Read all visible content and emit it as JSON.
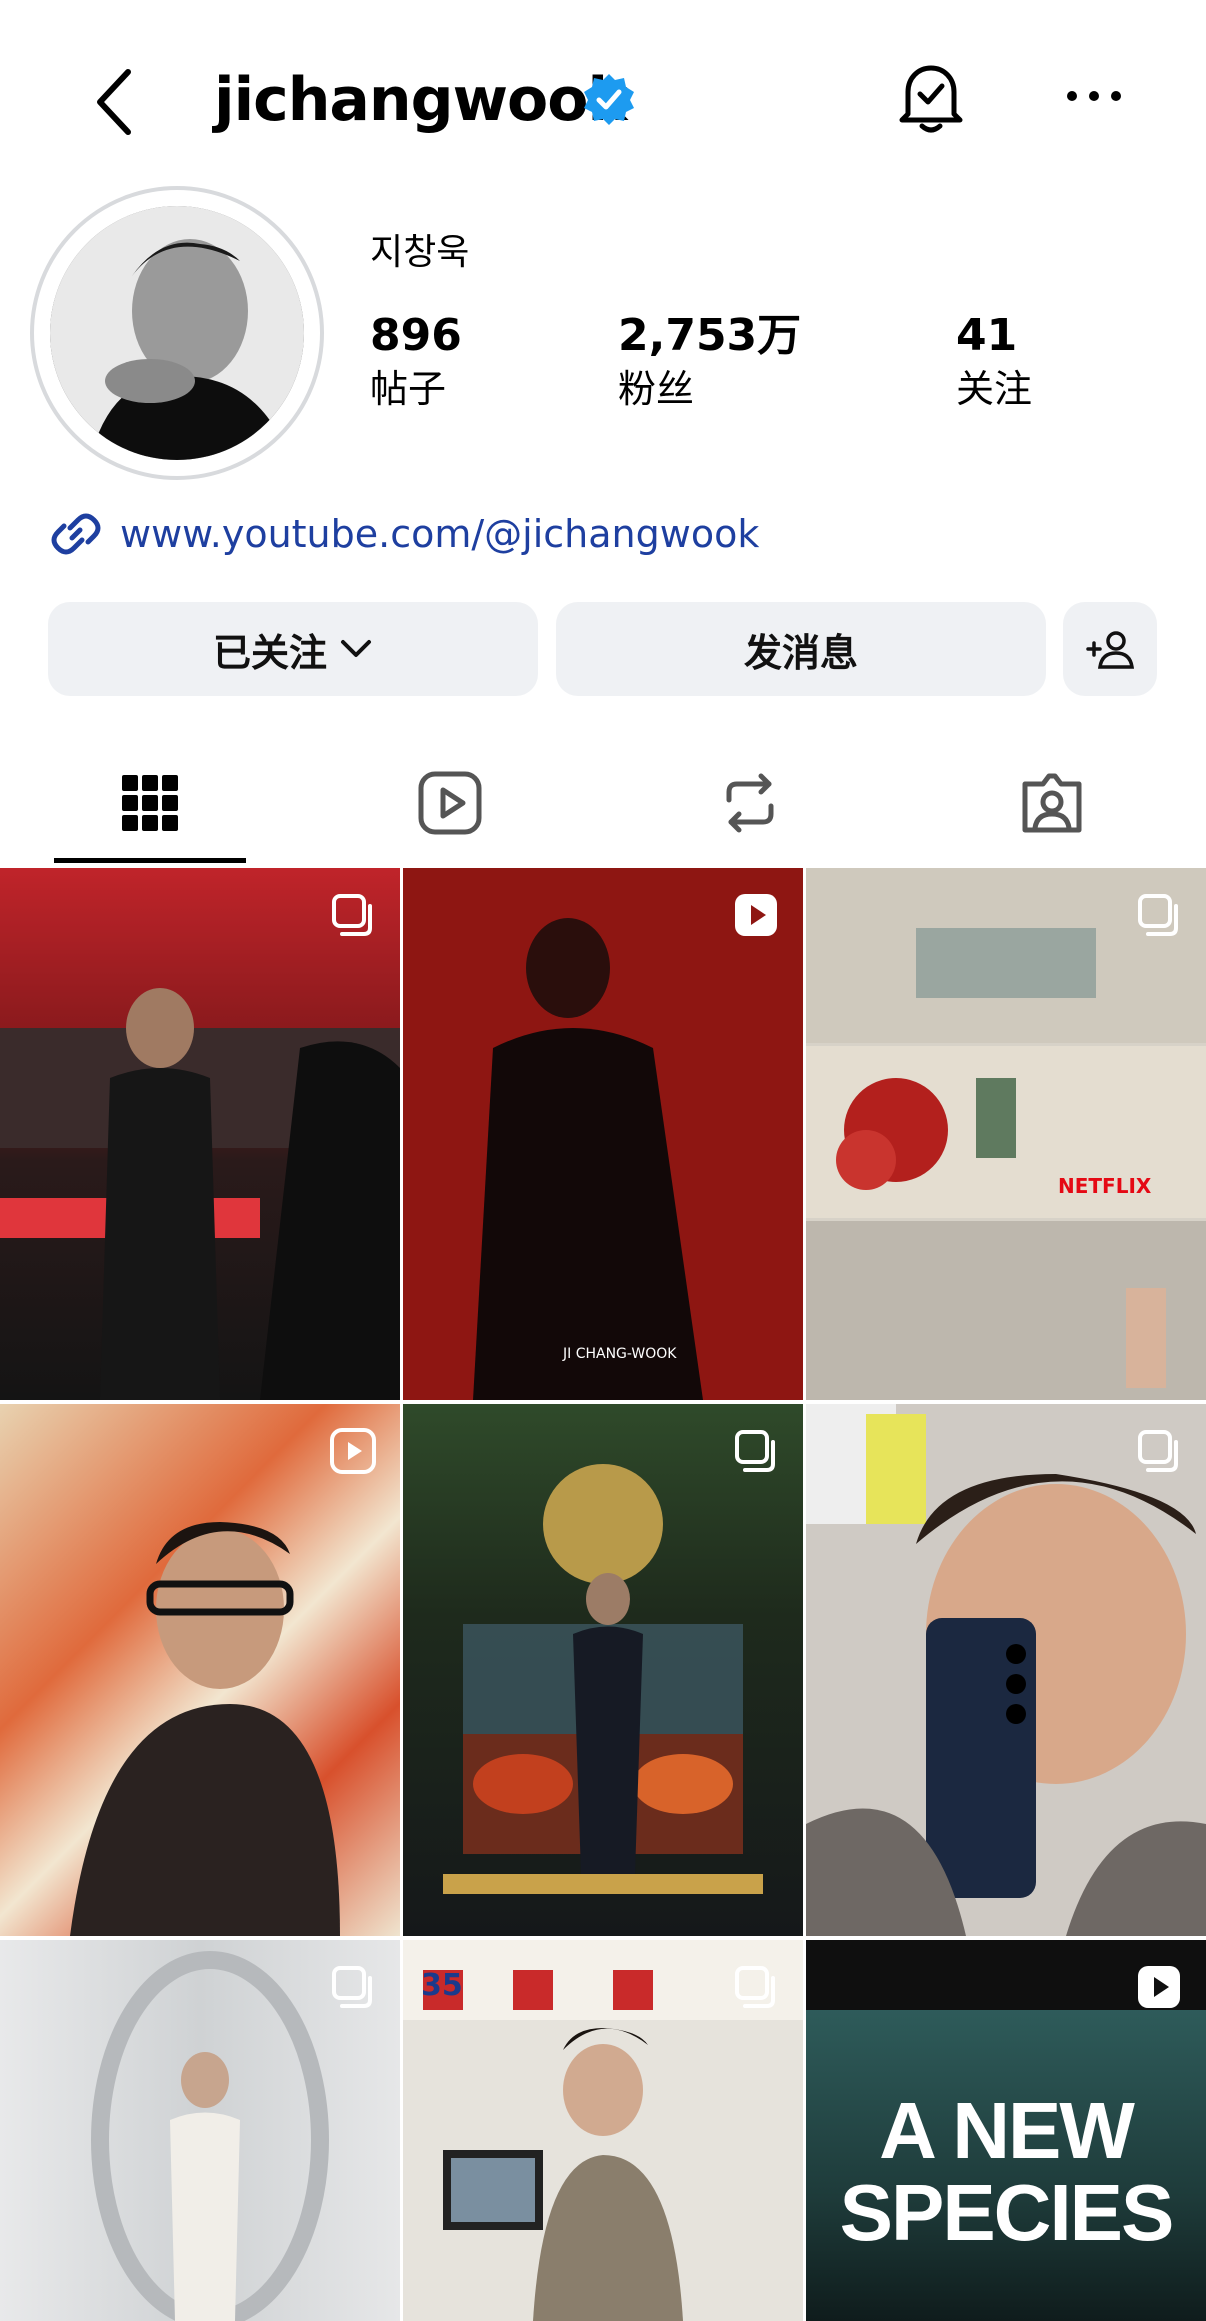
{
  "header": {
    "username": "jichangwook",
    "back_icon": "chevron-left-icon",
    "verified_icon": "verified-badge-icon",
    "bell_icon": "bell-check-icon",
    "more_icon": "more-horizontal-icon"
  },
  "profile": {
    "display_name": "지창욱",
    "stats": [
      {
        "value": "896",
        "label": "帖子"
      },
      {
        "value": "2,753万",
        "label": "粉丝"
      },
      {
        "value": "41",
        "label": "关注"
      }
    ],
    "link": "www.youtube.com/@jichangwook",
    "link_color": "#1e3fa0"
  },
  "actions": {
    "following_label": "已关注",
    "message_label": "发消息",
    "add_user_icon": "add-user-icon"
  },
  "tabs": [
    {
      "name": "posts",
      "icon": "grid-icon",
      "active": true
    },
    {
      "name": "reels",
      "icon": "reels-icon",
      "active": false
    },
    {
      "name": "reposts",
      "icon": "repost-icon",
      "active": false
    },
    {
      "name": "tagged",
      "icon": "tagged-icon",
      "active": false
    }
  ],
  "grid": [
    {
      "type": "carousel",
      "caption": ""
    },
    {
      "type": "reel",
      "caption": "JI CHANG-WOOK"
    },
    {
      "type": "carousel",
      "caption": "NETFLIX"
    },
    {
      "type": "reel",
      "caption": ""
    },
    {
      "type": "carousel",
      "caption": ""
    },
    {
      "type": "carousel",
      "caption": ""
    },
    {
      "type": "carousel",
      "caption": ""
    },
    {
      "type": "carousel",
      "caption": "35"
    },
    {
      "type": "reel",
      "caption": "A NEW SPECIES"
    }
  ]
}
